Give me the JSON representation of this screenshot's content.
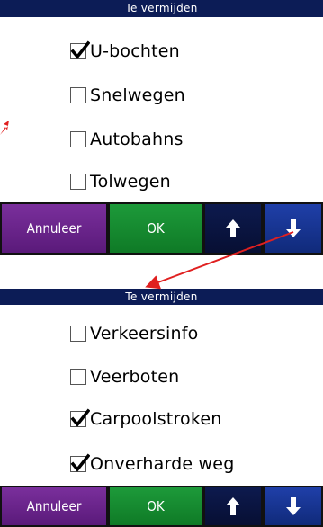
{
  "screens": [
    {
      "title": "Te vermijden",
      "options": [
        {
          "label": "U-bochten",
          "checked": true
        },
        {
          "label": "Snelwegen",
          "checked": false
        },
        {
          "label": "Autobahns",
          "checked": false
        },
        {
          "label": "Tolwegen",
          "checked": false
        }
      ],
      "buttons": {
        "cancel": "Annuleer",
        "ok": "OK"
      }
    },
    {
      "title": "Te vermijden",
      "options": [
        {
          "label": "Verkeersinfo",
          "checked": false
        },
        {
          "label": "Veerboten",
          "checked": false
        },
        {
          "label": "Carpoolstroken",
          "checked": true
        },
        {
          "label": "Onverharde weg",
          "checked": true
        }
      ],
      "buttons": {
        "cancel": "Annuleer",
        "ok": "OK"
      }
    }
  ],
  "colors": {
    "titlebar": "#0c1c56",
    "cancel": "#6a2489",
    "ok": "#14893a",
    "up": "#0a1440",
    "down": "#1a3690",
    "annotation_arrow": "#e02020"
  },
  "icons": {
    "check": "checkmark-icon",
    "up": "arrow-up-icon",
    "down": "arrow-down-icon",
    "annotation": "red-arrow-annotation"
  }
}
